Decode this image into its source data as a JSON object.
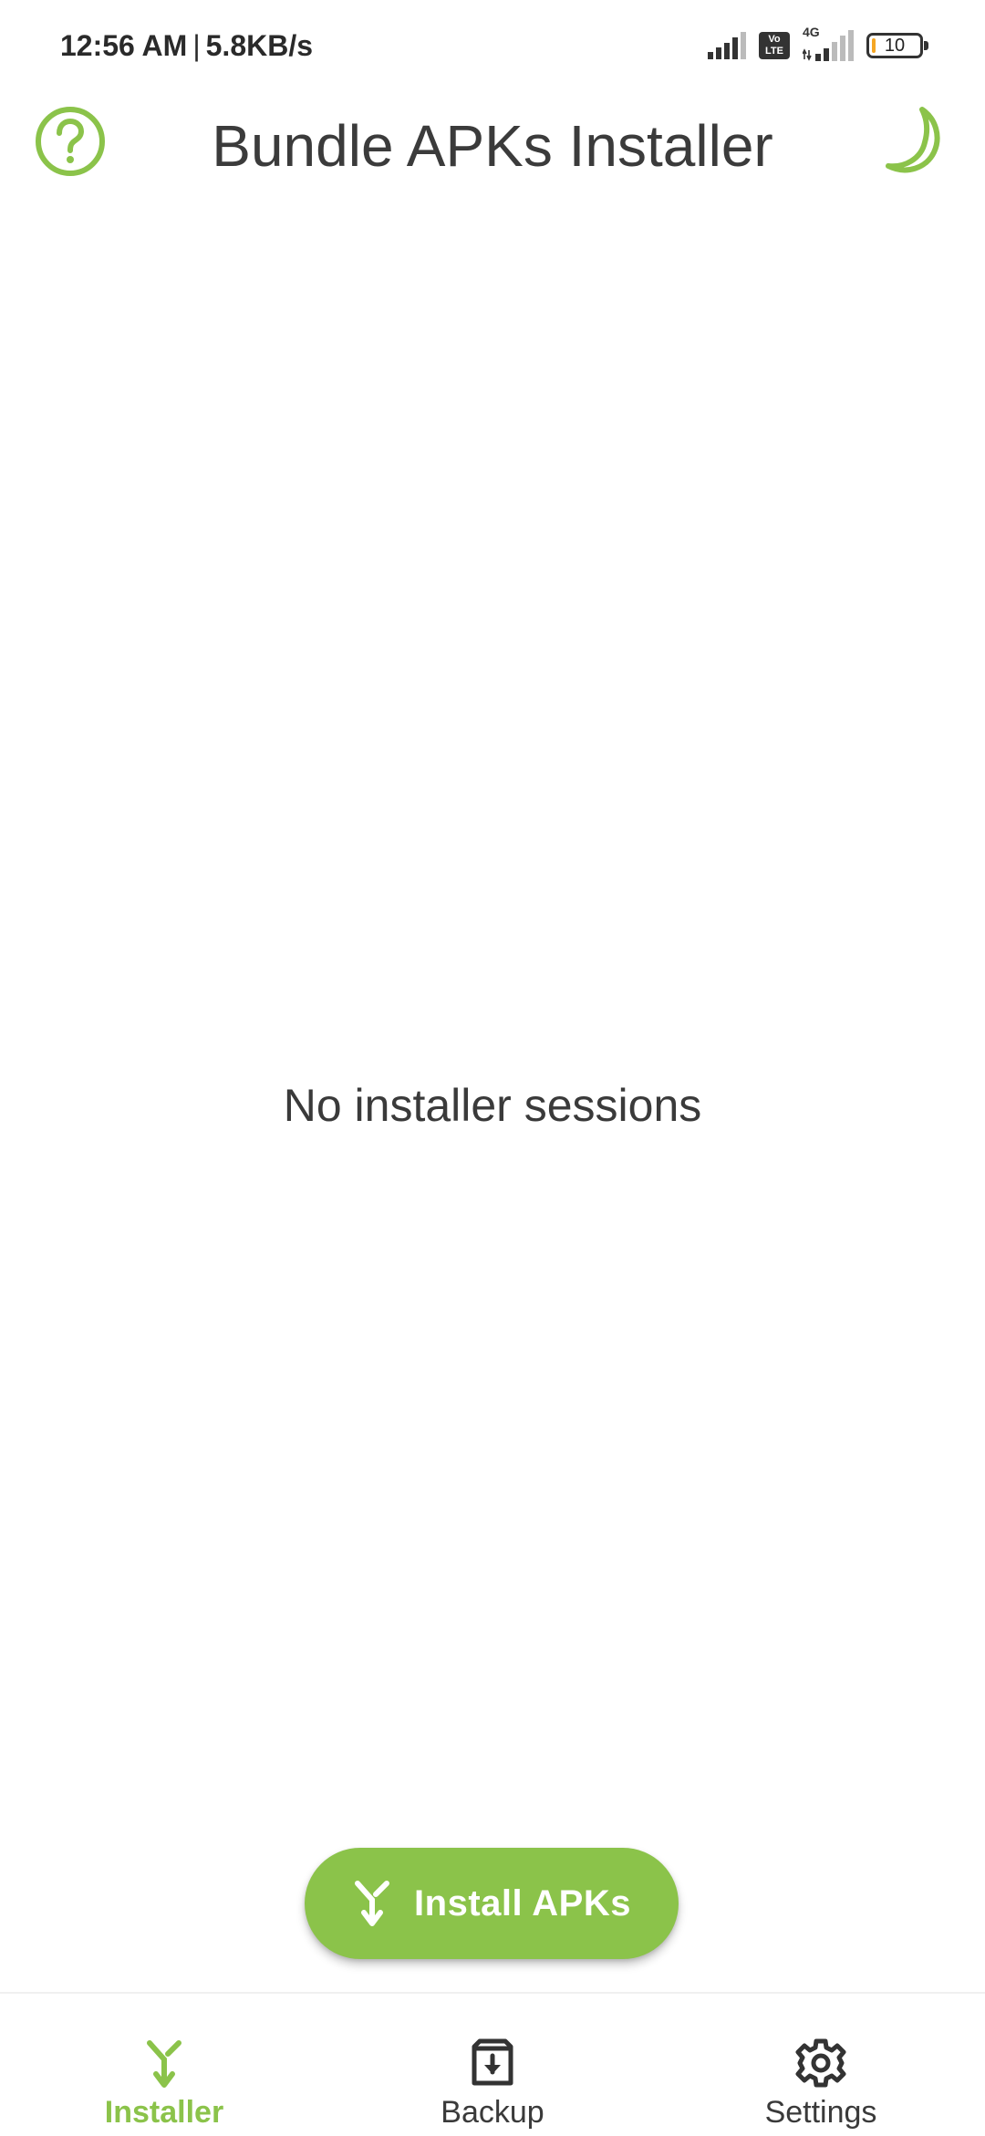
{
  "status_bar": {
    "time": "12:56 AM",
    "separator": "|",
    "net_speed": "5.8KB/s",
    "network_type": "4G",
    "volte_label_top": "Vo",
    "volte_label_bottom": "LTE",
    "battery_percent": "10"
  },
  "app_bar": {
    "title": "Bundle APKs Installer",
    "help_icon": "help-circle-icon",
    "theme_icon": "moon-icon"
  },
  "main": {
    "empty_message": "No installer sessions"
  },
  "fab": {
    "label": "Install APKs",
    "icon": "merge-arrow-icon"
  },
  "bottom_nav": {
    "items": [
      {
        "label": "Installer",
        "icon": "merge-arrow-icon",
        "active": true
      },
      {
        "label": "Backup",
        "icon": "archive-icon",
        "active": false
      },
      {
        "label": "Settings",
        "icon": "gear-icon",
        "active": false
      }
    ]
  },
  "colors": {
    "accent": "#8bc34a",
    "text_primary": "#3a3a3a",
    "background": "#ffffff"
  }
}
